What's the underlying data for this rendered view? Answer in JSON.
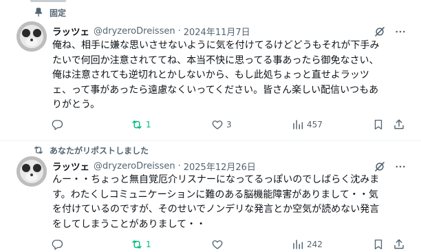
{
  "posts": [
    {
      "context_label": "固定",
      "author_name": "ラッツェ",
      "handle": "@dryzeroDreissen",
      "separator": "·",
      "date": "2024年11月7日",
      "text": "俺ね、相手に嫌な思いさせないように気を付けてるけどどうもそれが下手み\nたいで何回か注意されててね、本当不快に思ってる事あったら御免なさい、\n俺は注意されても逆切れとかしないから、もし此処ちょっと直せよラッツ\nェ、って事があったら遠慮なくいってください。皆さん楽しい配信いつもあ\nりがとう。",
      "replies": "",
      "reposts": "1",
      "likes": "3",
      "views": "457"
    },
    {
      "context_label": "あなたがリポストしました",
      "author_name": "ラッツェ",
      "handle": "@dryzeroDreissen",
      "separator": "·",
      "date": "2025年12月26日",
      "text": "んー・・ちょっと無自覚厄介リスナーになってるっぽいのでしばらく沈みま\nす。わたくしコミュニケーションに難のある脳機能障害がありまして・・気\nを付けているのですが、そのせいでノンデリな発言とか空気が読めない発言\nをしてしまうことがありまして・・",
      "replies": "",
      "reposts": "1",
      "likes": "",
      "views": "242"
    }
  ],
  "colors": {
    "text": "#0f1419",
    "secondary": "#536471",
    "repost_active": "#00ba7c",
    "divider": "#eff3f4"
  },
  "icons": [
    "pin-icon",
    "grok-icon",
    "more-icon",
    "reply-icon",
    "repost-icon",
    "like-icon",
    "views-icon",
    "bookmark-icon",
    "share-icon"
  ]
}
